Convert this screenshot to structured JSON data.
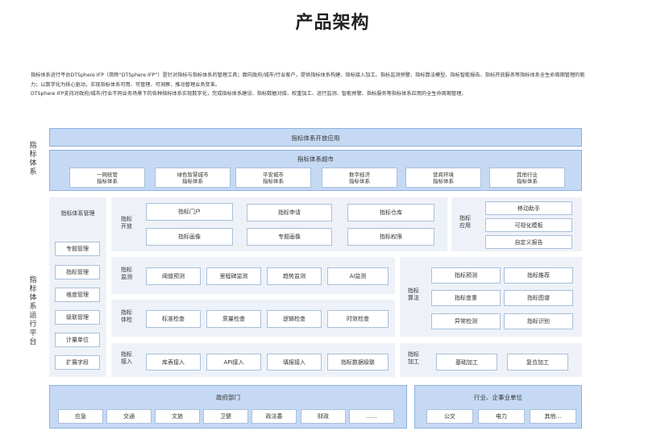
{
  "page_title": "产品架构",
  "intro": [
    "指标体系运行平台DTSphere IFP（简称“DTSphere IFP”）是针对指标与指标体系的管理工具；面向政府/城市/行业客户，提供指标体系构建、指标接入加工、指标监测预警、指标算法模型、指标智能报告、指标开放服务等指标体系全生命周期管理的能力；以数字化为核心驱动，实现指标体系可用、可管理、可洞察，推动管理业务变革。",
    "DTSphere IFP支持对政府/城市/行业不同业务场景下的各种指标体系实现数字化，完成指标体系建设、指标数据对接、权重加工、运行监测、智能预警、指标服务等指标体系应用的全生命周期管理。"
  ],
  "indicator_system": {
    "side_label": "指标体系",
    "open_app": "指标体系开放应用",
    "supermarket": {
      "title": "指标体系超市",
      "items": [
        {
          "line1": "一网统管",
          "line2": "指标体系"
        },
        {
          "line1": "绿色智慧城市",
          "line2": "指标体系"
        },
        {
          "line1": "平安城市",
          "line2": "指标体系"
        },
        {
          "line1": "数字经济",
          "line2": "指标体系"
        },
        {
          "line1": "营商环境",
          "line2": "指标体系"
        },
        {
          "line1": "其他行业",
          "line2": "指标体系"
        }
      ]
    }
  },
  "platform": {
    "side_label": "指标体系运行平台",
    "management": {
      "title": "指标体系管理",
      "items": [
        "专题管理",
        "指标管理",
        "维度管理",
        "级联管理",
        "计量单位",
        "扩展字段"
      ]
    },
    "open": {
      "label": "指标开放",
      "items": [
        "指标门户",
        "指标申请",
        "指标仓库",
        "指标画像",
        "专题画像",
        "指标权限"
      ]
    },
    "application": {
      "label": "指标应用",
      "items": [
        "移动助手",
        "可视化模板",
        "自定义报告"
      ]
    },
    "monitor": {
      "label": "指标监测",
      "items": [
        "阈值预测",
        "里程碑监测",
        "趋势监测",
        "AI监测"
      ]
    },
    "check": {
      "label": "指标体检",
      "items": [
        "标准检查",
        "质量检查",
        "逻辑检查",
        "时效检查"
      ]
    },
    "algorithm": {
      "label": "指标算法",
      "items": [
        "指标预测",
        "指标推荐",
        "指标查重",
        "指标图谱",
        "异常检测",
        "指标识别"
      ]
    },
    "access": {
      "label": "指标接入",
      "items": [
        "库表接入",
        "API接入",
        "填报接入",
        "指标数据级联"
      ]
    },
    "processing": {
      "label": "指标加工",
      "items": [
        "基础加工",
        "复合加工"
      ]
    }
  },
  "users": {
    "government": {
      "title": "政府部门",
      "items": [
        "应急",
        "交通",
        "文旅",
        "卫健",
        "政法委",
        "财政",
        "……"
      ]
    },
    "industry": {
      "title": "行业、企事业单位",
      "items": [
        "公交",
        "电力",
        "其他…"
      ]
    }
  }
}
